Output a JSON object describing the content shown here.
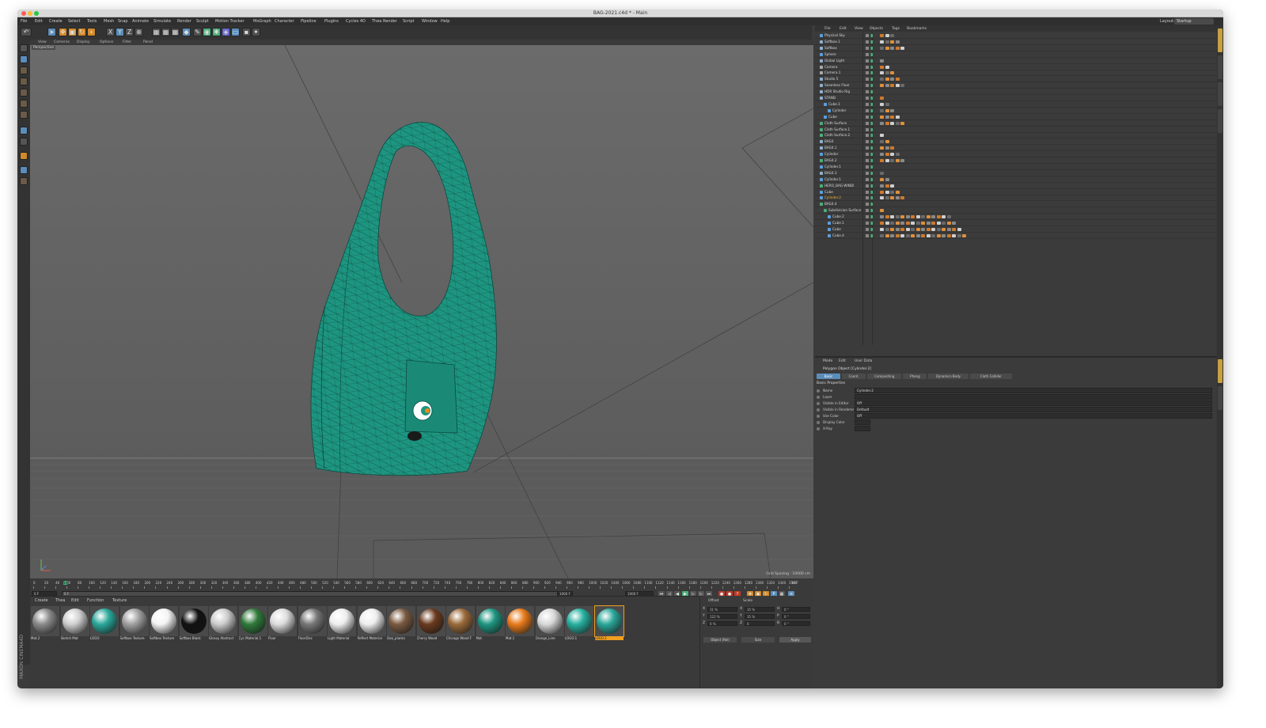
{
  "window": {
    "title": "BAG-2021.c4d * - Main",
    "layout_label": "Layout:",
    "layout_value": "Startup"
  },
  "menubar": [
    "File",
    "Edit",
    "Create",
    "Select",
    "Tools",
    "Mesh",
    "Snap",
    "Animate",
    "Simulate",
    "Render",
    "Sculpt",
    "Motion Tracker",
    "MoGraph",
    "Character",
    "Pipeline",
    "Plugins",
    "Cycles 4D",
    "Thea Render",
    "Script",
    "Window",
    "Help"
  ],
  "viewport": {
    "menu": [
      "View",
      "Cameras",
      "Display",
      "Options",
      "Filter",
      "Panel"
    ],
    "camera_label": "Perspective",
    "grid_spacing": "Grid Spacing : 10000 cm",
    "object_color": "#1d9580"
  },
  "timeline": {
    "ticks": [
      "0",
      "20",
      "40",
      "60",
      "80",
      "100",
      "120",
      "140",
      "160",
      "180",
      "200",
      "220",
      "240",
      "260",
      "280",
      "300",
      "320",
      "340",
      "360",
      "380",
      "400",
      "420",
      "440",
      "460",
      "480",
      "500",
      "520",
      "540",
      "560",
      "580",
      "600",
      "620",
      "640",
      "660",
      "680",
      "700",
      "720",
      "740",
      "760",
      "780",
      "800",
      "820",
      "840",
      "860",
      "880",
      "900",
      "920",
      "940",
      "960",
      "980",
      "1000",
      "1020",
      "1040",
      "1060",
      "1080",
      "1100",
      "1120",
      "1140",
      "1160",
      "1180",
      "1200",
      "1220",
      "1240",
      "1260",
      "1280",
      "1300",
      "1320",
      "1340",
      "1360"
    ],
    "current_frame_marker": "54",
    "end_marker": "54 F",
    "start_field": "0 F",
    "min_field": "0 F",
    "max_field": "1000 F",
    "end_field": "1000 F"
  },
  "materials": {
    "menu": [
      "Create",
      "Thea",
      "Edit",
      "Function",
      "Texture"
    ],
    "items": [
      {
        "label": "Mat.2",
        "color": "#8a8a8a"
      },
      {
        "label": "Sketch Mat",
        "color": "#cfcfcf"
      },
      {
        "label": "LOGO",
        "color": "#2aa79a"
      },
      {
        "label": "Softbox Texture",
        "color": "#a0a0a0"
      },
      {
        "label": "Softbox Texture",
        "color": "#f4f4f4"
      },
      {
        "label": "Softbox Black",
        "color": "#111111"
      },
      {
        "label": "Glossy Abstract",
        "color": "#cccccc"
      },
      {
        "label": "Cyc Material.1",
        "color": "#2f7a3a"
      },
      {
        "label": "Floor",
        "color": "#dcdcdc"
      },
      {
        "label": "FloorDisc",
        "color": "#777777"
      },
      {
        "label": "Light Material",
        "color": "#eeeeee"
      },
      {
        "label": "Reflect Material",
        "color": "#eeeeee"
      },
      {
        "label": "Oak_planks",
        "color": "#7a5a40"
      },
      {
        "label": "Cherry Wood",
        "color": "#6a3a1e"
      },
      {
        "label": "Chicago Wood F",
        "color": "#9a6a3a"
      },
      {
        "label": "Mat",
        "color": "#1d9580"
      },
      {
        "label": "Mat.1",
        "color": "#e87a1a"
      },
      {
        "label": "Orange_Line",
        "color": "#d8d8d8"
      },
      {
        "label": "LOGO.1",
        "color": "#27b0a0"
      },
      {
        "label": "LOGO.2",
        "color": "#2aa79a"
      }
    ],
    "selected_index": 19
  },
  "coordinates": {
    "headers": {
      "position": "Offset",
      "size": "Scale"
    },
    "rows": [
      {
        "axis": "X",
        "pos": "31 %",
        "axis2": "X",
        "size": "35 %",
        "axis3": "H",
        "rot": "0 °"
      },
      {
        "axis": "Y",
        "pos": "122 %",
        "axis2": "Y",
        "size": "35 %",
        "axis3": "P",
        "rot": "0 °"
      },
      {
        "axis": "Z",
        "pos": "0 %",
        "axis2": "Z",
        "size": "0",
        "axis3": "B",
        "rot": "0 °"
      }
    ],
    "mode_1": "Object (Rel)",
    "mode_2": "Size",
    "apply_label": "Apply"
  },
  "object_manager": {
    "menu": [
      "File",
      "Edit",
      "View",
      "Objects",
      "Tags",
      "Bookmarks"
    ],
    "objects": [
      {
        "name": "Physical Sky",
        "indent": 0,
        "icon": "#5aa0e0"
      },
      {
        "name": "Softbox.1",
        "indent": 0,
        "icon": "#8fb0d0"
      },
      {
        "name": "Softbox",
        "indent": 0,
        "icon": "#8fb0d0"
      },
      {
        "name": "Sphere",
        "indent": 0,
        "icon": "#5aa0e0"
      },
      {
        "name": "Global Light",
        "indent": 0,
        "icon": "#8fb0d0"
      },
      {
        "name": "Camera",
        "indent": 0,
        "icon": "#aaaaaa"
      },
      {
        "name": "Camera.1",
        "indent": 0,
        "icon": "#aaaaaa"
      },
      {
        "name": "Studio 5",
        "indent": 0,
        "icon": "#8fb0d0"
      },
      {
        "name": "Seamless Floor",
        "indent": 0,
        "icon": "#8fb0d0"
      },
      {
        "name": "HDR Studio Rig",
        "indent": 0,
        "icon": "#8fb0d0"
      },
      {
        "name": "STAND",
        "indent": 0,
        "icon": "#8fb0d0"
      },
      {
        "name": "Cube.1",
        "indent": 1,
        "icon": "#5aa0e0"
      },
      {
        "name": "Cylinder",
        "indent": 2,
        "icon": "#5aa0e0"
      },
      {
        "name": "Cube",
        "indent": 1,
        "icon": "#5aa0e0"
      },
      {
        "name": "Cloth Surface",
        "indent": 0,
        "icon": "#4ab07a"
      },
      {
        "name": "Cloth Surface.1",
        "indent": 0,
        "icon": "#4ab07a"
      },
      {
        "name": "Cloth Surface.2",
        "indent": 0,
        "icon": "#4ab07a"
      },
      {
        "name": "BAG4",
        "indent": 0,
        "icon": "#8fb0d0"
      },
      {
        "name": "BAG4.1",
        "indent": 0,
        "icon": "#8fb0d0"
      },
      {
        "name": "Cylinder",
        "indent": 0,
        "icon": "#5aa0e0"
      },
      {
        "name": "BAG4.2",
        "indent": 0,
        "icon": "#4ab07a"
      },
      {
        "name": "Cylinder.1",
        "indent": 0,
        "icon": "#5aa0e0"
      },
      {
        "name": "BAG4.3",
        "indent": 0,
        "icon": "#8fb0d0"
      },
      {
        "name": "Cylinder.1",
        "indent": 0,
        "icon": "#5aa0e0"
      },
      {
        "name": "HERO_BAG-WINDI",
        "indent": 0,
        "icon": "#4ab07a"
      },
      {
        "name": "Cube",
        "indent": 0,
        "icon": "#5aa0e0"
      },
      {
        "name": "Cylinder.2",
        "indent": 0,
        "icon": "#5aa0e0",
        "selected": true
      },
      {
        "name": "BAG4.4",
        "indent": 0,
        "icon": "#4ab07a"
      },
      {
        "name": "Subdivision Surface",
        "indent": 1,
        "icon": "#4ab07a"
      },
      {
        "name": "Cube.2",
        "indent": 2,
        "icon": "#5aa0e0"
      },
      {
        "name": "Cube.1",
        "indent": 2,
        "icon": "#5aa0e0"
      },
      {
        "name": "Cube",
        "indent": 2,
        "icon": "#5aa0e0"
      },
      {
        "name": "Cube.4",
        "indent": 2,
        "icon": "#5aa0e0"
      }
    ]
  },
  "attributes": {
    "menu": [
      "Mode",
      "Edit",
      "User Data"
    ],
    "object_title": "Polygon Object [Cylinder.2]",
    "tabs": [
      "Basic",
      "Coord.",
      "Compositing",
      "Phong",
      "Dynamics Body",
      "Cloth Collider"
    ],
    "active_tab": 0,
    "section_title": "Basic Properties",
    "fields": [
      {
        "label": "Name",
        "value": "Cylinder.2"
      },
      {
        "label": "Layer",
        "value": ""
      },
      {
        "label": "Visible in Editor",
        "value": "Off"
      },
      {
        "label": "Visible in Renderer",
        "value": "Default"
      },
      {
        "label": "Use Color",
        "value": "Off"
      },
      {
        "label": "Display Color",
        "value": ""
      },
      {
        "label": "X-Ray",
        "value": ""
      }
    ]
  },
  "brand": "MAXON CINEMA4D"
}
